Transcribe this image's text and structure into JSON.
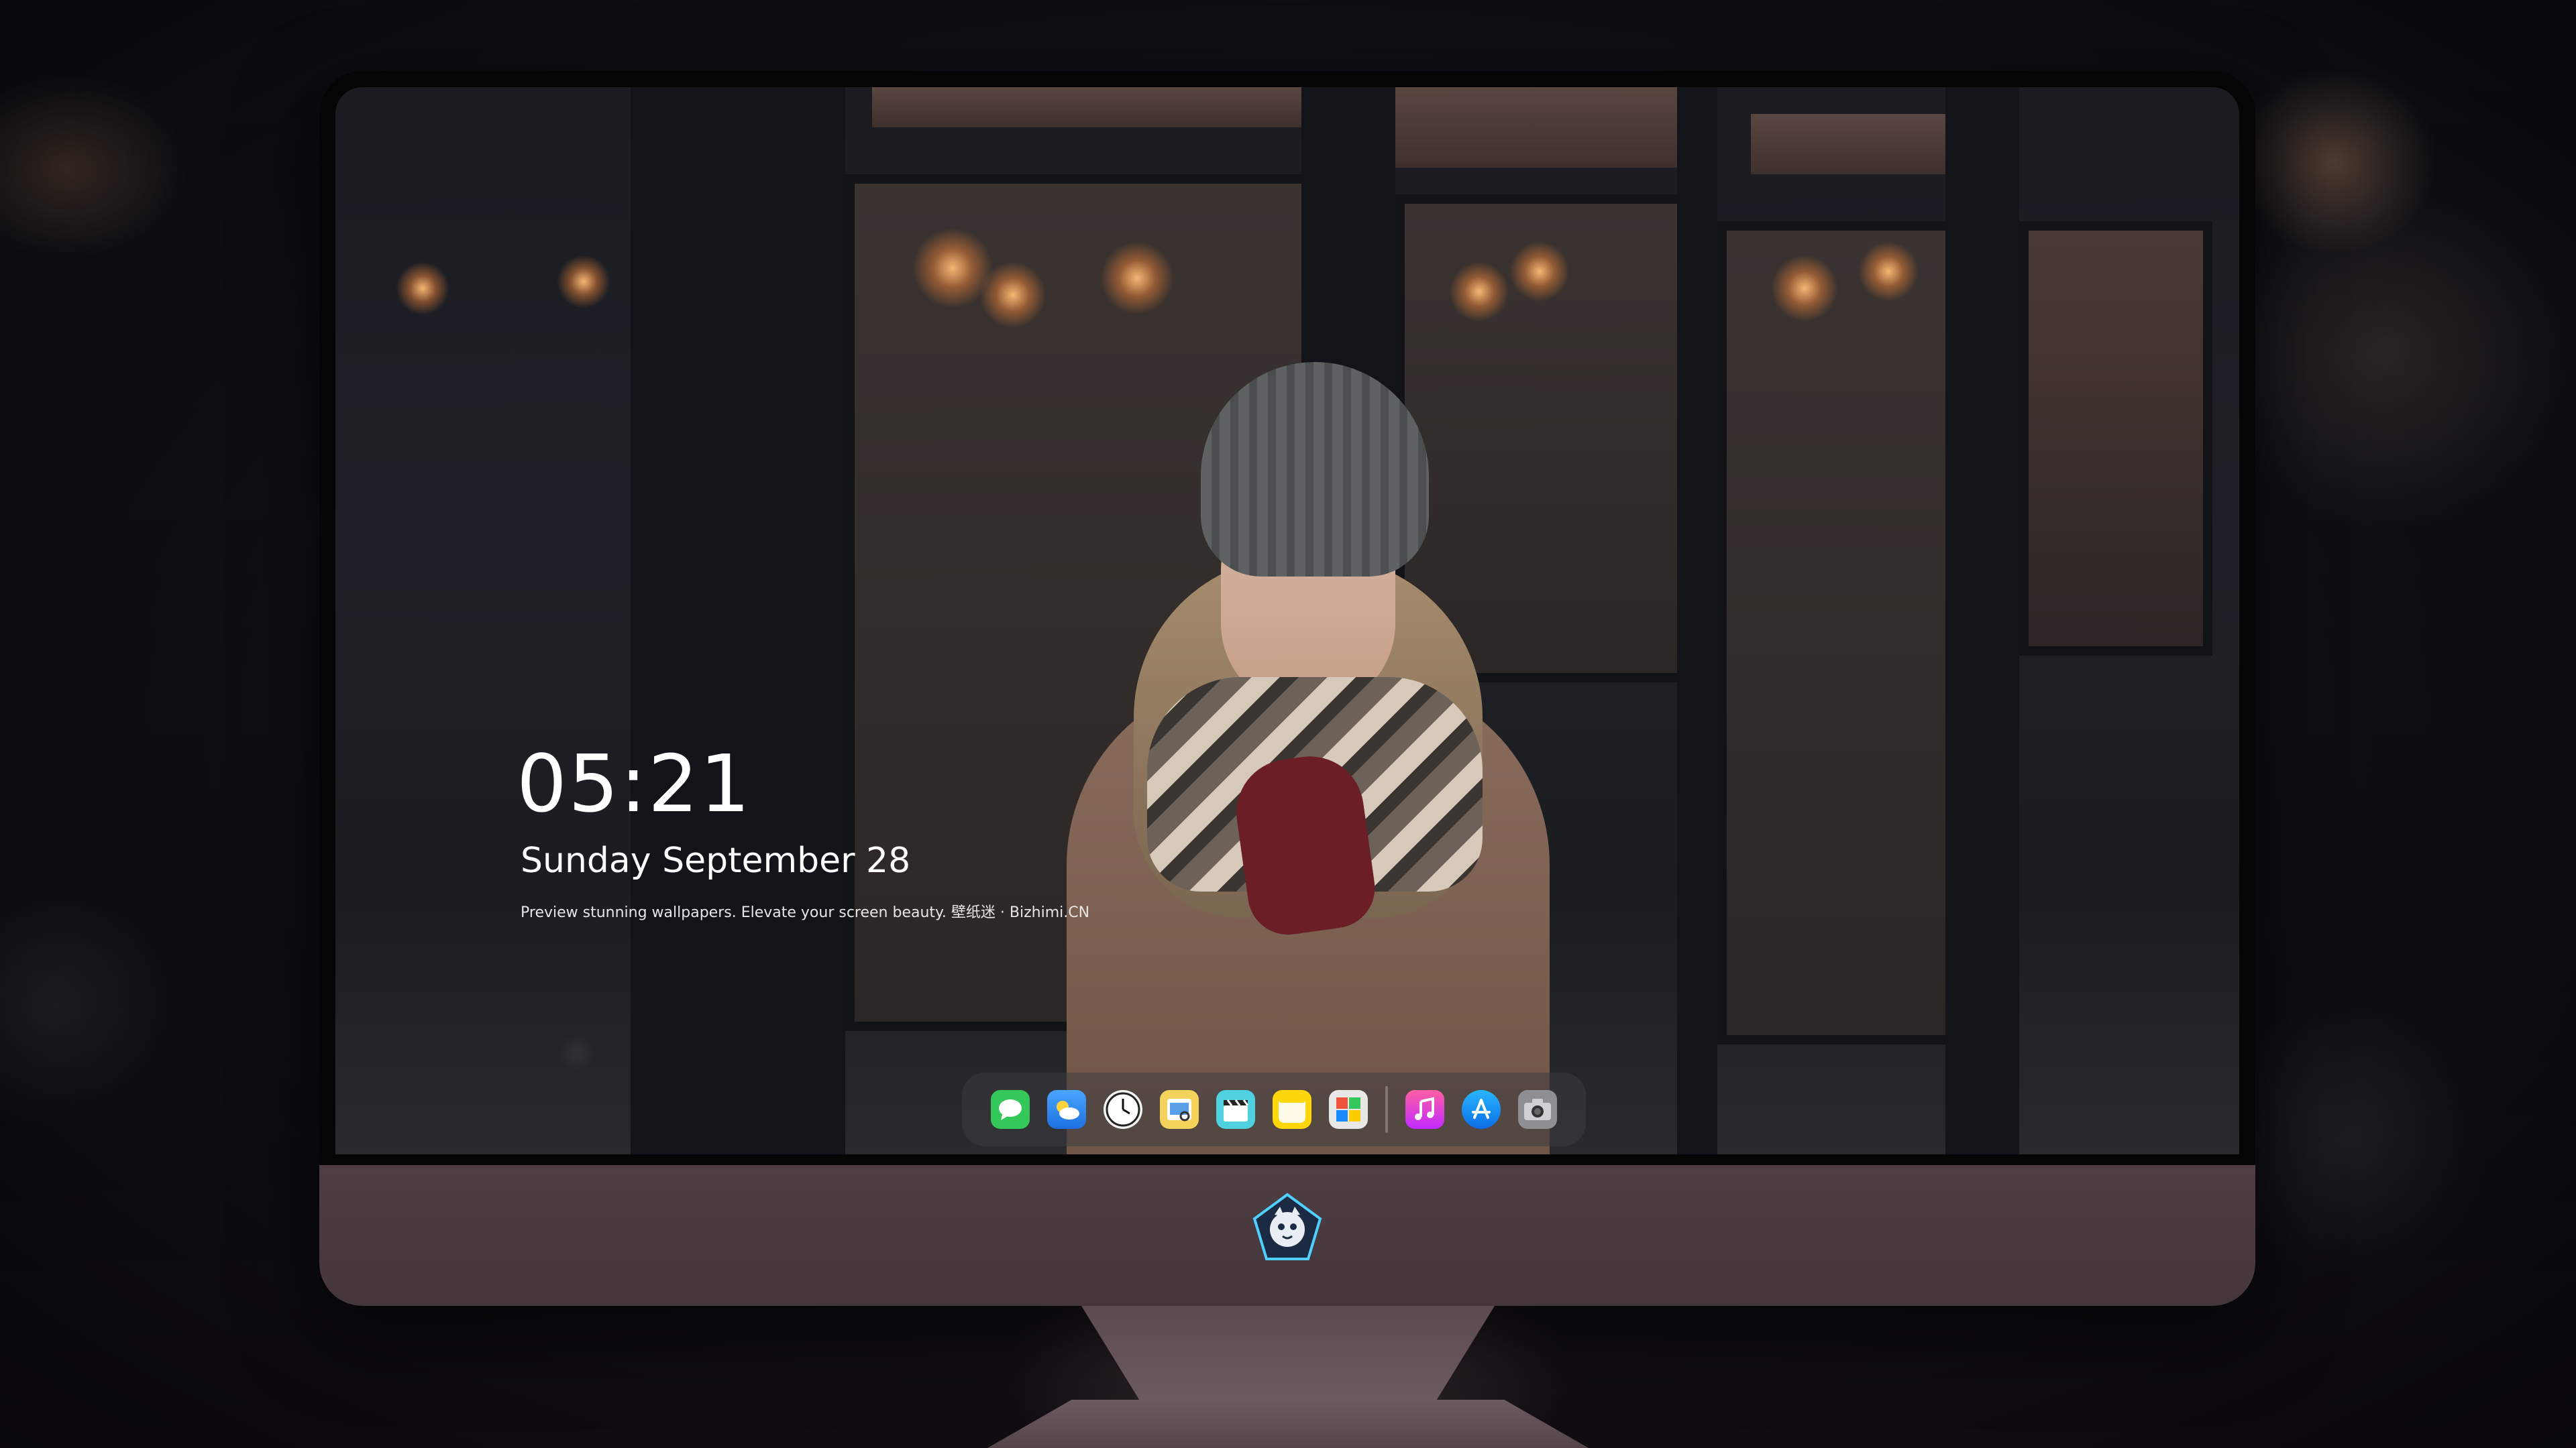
{
  "lockscreen": {
    "time": "05:21",
    "date": "Sunday September  28",
    "tagline": "Preview stunning wallpapers. Elevate your screen beauty. 壁纸迷 · Bizhimi.CN"
  },
  "dock": {
    "apps": [
      {
        "name": "Messages",
        "icon": "messages-icon",
        "color": "#34c759"
      },
      {
        "name": "Weather",
        "icon": "weather-icon",
        "color": "#2f8cf0"
      },
      {
        "name": "Clock",
        "icon": "clock-icon",
        "color": "#f2f2f2"
      },
      {
        "name": "Preview",
        "icon": "preview-icon",
        "color": "#f3d35c"
      },
      {
        "name": "Clips",
        "icon": "clips-icon",
        "color": "#4fd1e0"
      },
      {
        "name": "Notes",
        "icon": "notes-icon",
        "color": "#ffd60a"
      },
      {
        "name": "Photos",
        "icon": "photos-icon",
        "color": "#e8e8e8"
      },
      {
        "name": "Music",
        "icon": "music-icon",
        "color": "#fc3c8c"
      },
      {
        "name": "App Store",
        "icon": "app-store-icon",
        "color": "#1a8cff"
      },
      {
        "name": "Camera",
        "icon": "camera-icon",
        "color": "#8e8e93"
      }
    ]
  },
  "monitor": {
    "chin_logo": "mascot-logo",
    "chin_color": "#4d3e43"
  }
}
